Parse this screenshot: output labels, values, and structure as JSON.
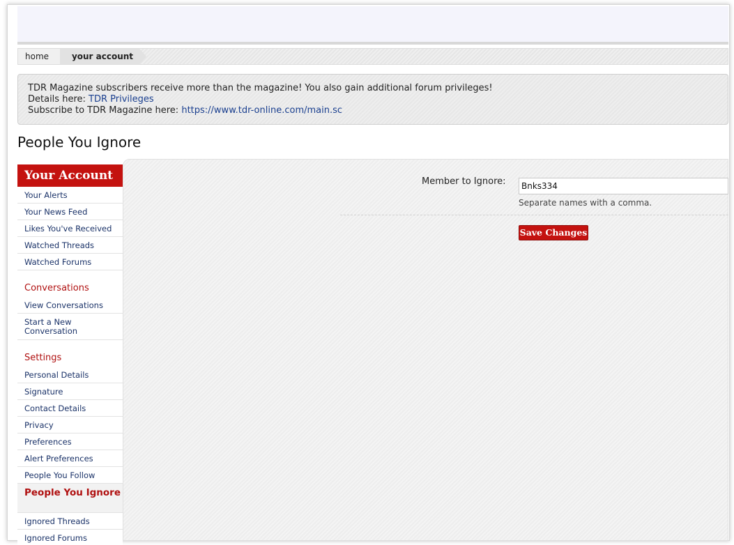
{
  "breadcrumb": {
    "home": "home",
    "current": "your account"
  },
  "notice": {
    "line1": "TDR Magazine subscribers receive more than the magazine! You also gain additional forum privileges!",
    "details_prefix": "Details here: ",
    "details_link": "TDR Privileges",
    "subscribe_prefix": "Subscribe to TDR Magazine here: ",
    "subscribe_link": "https://www.tdr-online.com/main.sc"
  },
  "page_title": "People You Ignore",
  "sidebar": {
    "heading": "Your Account",
    "group1": [
      "Your Alerts",
      "Your News Feed",
      "Likes You've Received",
      "Watched Threads",
      "Watched Forums"
    ],
    "conversations_heading": "Conversations",
    "conversations": [
      "View Conversations",
      "Start a New Conversation"
    ],
    "settings_heading": "Settings",
    "settings": [
      "Personal Details",
      "Signature",
      "Contact Details",
      "Privacy",
      "Preferences",
      "Alert Preferences",
      "People You Follow"
    ],
    "active": "People You Ignore",
    "after_active": [
      "Ignored Threads",
      "Ignored Forums"
    ]
  },
  "form": {
    "member_label": "Member to Ignore:",
    "member_value": "Bnks334",
    "hint": "Separate names with a comma.",
    "save_label": "Save Changes"
  },
  "colors": {
    "accent": "#c4120f",
    "link": "#1a3268"
  }
}
